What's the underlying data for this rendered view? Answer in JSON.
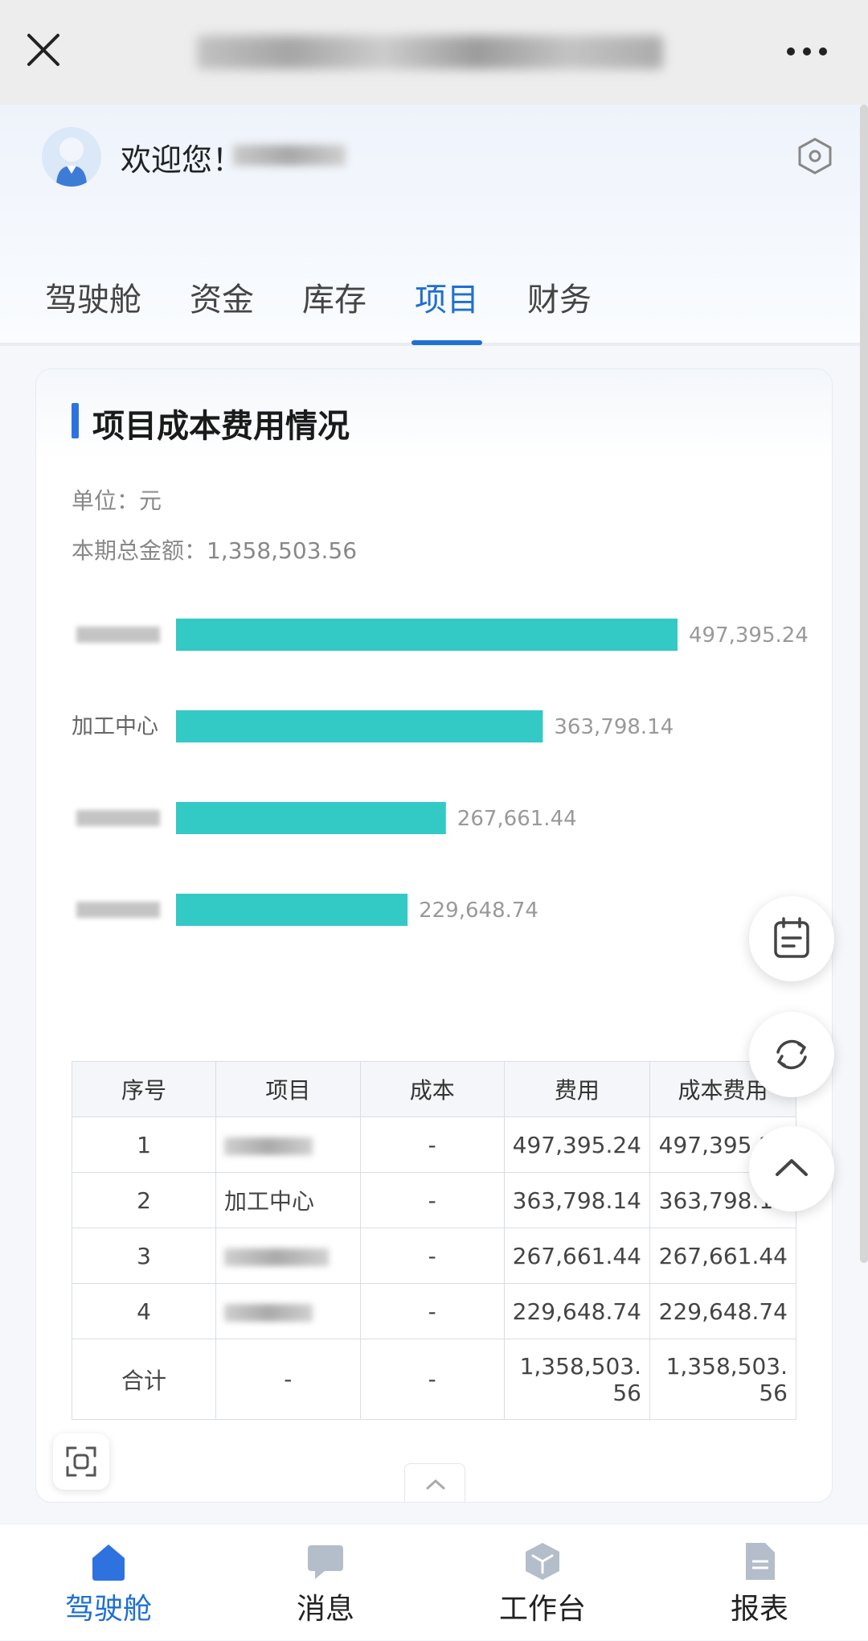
{
  "header": {
    "welcome": "欢迎您！"
  },
  "tabs": [
    {
      "label": "驾驶舱",
      "active": false
    },
    {
      "label": "资金",
      "active": false
    },
    {
      "label": "库存",
      "active": false
    },
    {
      "label": "项目",
      "active": true
    },
    {
      "label": "财务",
      "active": false
    }
  ],
  "card": {
    "title": "项目成本费用情况",
    "unit": "单位：元",
    "total": "本期总金额：1,358,503.56"
  },
  "chart_data": {
    "type": "bar",
    "orientation": "horizontal",
    "categories": [
      "",
      "加工中心",
      "",
      ""
    ],
    "values": [
      497395.24,
      363798.14,
      267661.44,
      229648.74
    ],
    "value_labels": [
      "497,395.24",
      "363,798.14",
      "267,661.44",
      "229,648.74"
    ],
    "color": "#33c9c5",
    "title": "",
    "xlabel": "",
    "ylabel": "",
    "grid": false
  },
  "table": {
    "headers": [
      "序号",
      "项目",
      "成本",
      "费用",
      "成本费用"
    ],
    "rows": [
      [
        "1",
        "",
        "-",
        "497,395.24",
        "497,395.24"
      ],
      [
        "2",
        "加工中心",
        "-",
        "363,798.14",
        "363,798.14"
      ],
      [
        "3",
        "",
        "-",
        "267,661.44",
        "267,661.44"
      ],
      [
        "4",
        "",
        "-",
        "229,648.74",
        "229,648.74"
      ]
    ],
    "total_row": [
      "合计",
      "-",
      "-",
      "1,358,503.56",
      "1,358,503.56"
    ]
  },
  "bottom_nav": [
    {
      "label": "驾驶舱",
      "icon": "home-icon",
      "active": true
    },
    {
      "label": "消息",
      "icon": "message-icon",
      "active": false
    },
    {
      "label": "工作台",
      "icon": "cube-icon",
      "active": false
    },
    {
      "label": "报表",
      "icon": "document-icon",
      "active": false
    }
  ],
  "colors": {
    "accent": "#1f6fd2",
    "bar": "#33c9c5"
  }
}
